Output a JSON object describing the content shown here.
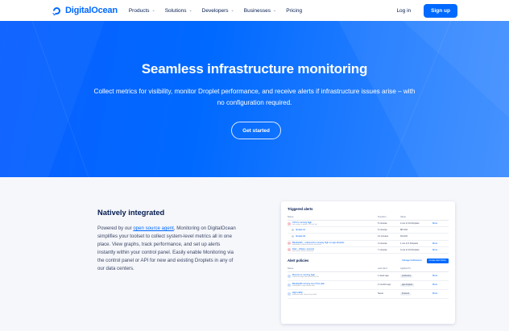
{
  "brand": {
    "name": "DigitalOcean",
    "color": "#0069ff"
  },
  "nav": {
    "menu": [
      {
        "label": "Products"
      },
      {
        "label": "Solutions"
      },
      {
        "label": "Developers"
      },
      {
        "label": "Businesses"
      },
      {
        "label": "Pricing"
      }
    ],
    "login_label": "Log in",
    "signup_label": "Sign up"
  },
  "hero": {
    "title": "Seamless infrastructure monitoring",
    "subtitle": "Collect metrics for visibility, monitor Droplet performance, and receive alerts if infrastructure issues arise – with no configuration required.",
    "cta_label": "Get started"
  },
  "feature": {
    "title": "Natively integrated",
    "body_before": "Powered by our ",
    "body_link": "open source agent",
    "body_after": ", Monitoring on DigitalOcean simplifies your toolset to collect system-level metrics all in one place. View graphs, track performance, and set up alerts instantly within your control panel. Easily enable Monitoring via the control panel or API for new and existing Droplets in any of our data centers."
  },
  "mockup": {
    "triggered_title": "Triggered alerts",
    "triggered_headers": [
      "Name",
      "Duration",
      "Value",
      ""
    ],
    "triggered_rows": [
      {
        "name": "CPU is running high",
        "meta": "cpu usage is above 70% for 5m",
        "duration": "5 minutes",
        "value": "2 out of 10 Droplets",
        "action": "More",
        "sub": false
      },
      {
        "name": "droplet-01",
        "meta": "",
        "duration": "5 minutes",
        "value": "88.12%",
        "action": "",
        "sub": true
      },
      {
        "name": "droplet-02",
        "meta": "",
        "duration": "14 minutes",
        "value": "93.22%",
        "action": "",
        "sub": true
      },
      {
        "name": "Bandwidth – outbound is running high on app-droplets",
        "meta": "bandwidth outbound above threshold",
        "duration": "3 minutes",
        "value": "1 out of 3 Droplets",
        "action": "More",
        "sub": false
      },
      {
        "name": "Disk – Writes / second",
        "meta": "disk writes above threshold",
        "duration": "7 minutes",
        "value": "3 out of 10 Droplets",
        "action": "More",
        "sub": false
      }
    ],
    "policies_title": "Alert policies",
    "policies_btn_1": "Manage Notifications",
    "policies_btn_2": "Create Alert Policy",
    "policies_headers": [
      "Name",
      "Last Alert",
      "Applied To",
      ""
    ],
    "policies_rows": [
      {
        "name": "Memory is running high",
        "meta": "memory usage above 80% for 5m",
        "last": "1 week ago",
        "tag": "production",
        "action": "More"
      },
      {
        "name": "Bandwidth running out of the plan",
        "meta": "bandwidth usage above plan",
        "last": "2 months ago",
        "tag": "app-droplets",
        "action": "More"
      },
      {
        "name": "High traffic",
        "meta": "inbound traffic above threshold",
        "last": "Never",
        "tag": "frontend",
        "action": "More"
      }
    ]
  }
}
